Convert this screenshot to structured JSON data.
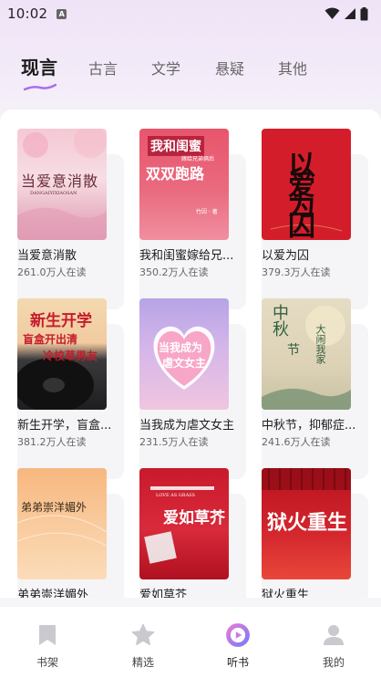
{
  "status_bar": {
    "time": "10:02",
    "badge": "A"
  },
  "tabs": [
    {
      "label": "现言",
      "active": true
    },
    {
      "label": "古言",
      "active": false
    },
    {
      "label": "文学",
      "active": false
    },
    {
      "label": "悬疑",
      "active": false
    },
    {
      "label": "其他",
      "active": false
    }
  ],
  "books": [
    {
      "title": "当爱意消散",
      "reads": "261.0万人在读",
      "cover_text": "当爱意消散",
      "cover_sub": "DANGAIYIXIAOSAN"
    },
    {
      "title": "我和闺蜜嫁给兄...",
      "reads": "350.2万人在读",
      "cover_text_1": "我和闺蜜",
      "cover_text_2": "嫁给兄弟俩后",
      "cover_text_3": "双双跑路",
      "cover_author": "竹因 · 著"
    },
    {
      "title": "以爱为囚",
      "reads": "379.3万人在读",
      "cover_text": "以爱为囚"
    },
    {
      "title": "新生开学，盲盒...",
      "reads": "381.2万人在读",
      "cover_text_1": "新生开学",
      "cover_text_2": "盲盒开出清",
      "cover_text_3": "冷校草男友"
    },
    {
      "title": "当我成为虐文女主",
      "reads": "231.5万人在读",
      "cover_text_1": "当我成为",
      "cover_text_2": "虐文女主"
    },
    {
      "title": "中秋节，抑郁症...",
      "reads": "241.6万人在读",
      "cover_text_1": "中秋",
      "cover_text_2": "节",
      "cover_text_3": "大闹我家"
    },
    {
      "title": "弟弟崇洋媚外",
      "reads": "",
      "cover_text": "弟弟崇洋媚外"
    },
    {
      "title": "爱如草芥",
      "reads": "",
      "cover_text": "爱如草芥",
      "cover_sub": "LOVE AS GRASS"
    },
    {
      "title": "狱火重生",
      "reads": "",
      "cover_text": "狱火重生"
    }
  ],
  "bottom_nav": [
    {
      "label": "书架",
      "icon": "bookmark-icon",
      "active": false
    },
    {
      "label": "精选",
      "icon": "star-icon",
      "active": false
    },
    {
      "label": "听书",
      "icon": "play-circle-icon",
      "active": true
    },
    {
      "label": "我的",
      "icon": "user-icon",
      "active": false
    }
  ],
  "colors": {
    "accent": "#a86ff0",
    "nav_gradient_start": "#f07ad8",
    "nav_gradient_end": "#6f7cf7"
  }
}
